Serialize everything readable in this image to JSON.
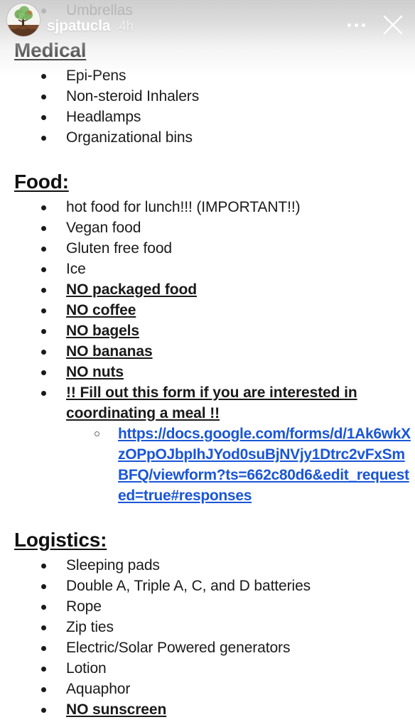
{
  "story": {
    "username": "sjpatucla",
    "timestamp": "4h",
    "avatar_alt": "tree-avatar",
    "more_options_label": "More options",
    "close_label": "Close"
  },
  "colors": {
    "link": "#1a56d6",
    "text": "#1a1a1a",
    "overlay_text": "#ffffff",
    "background": "#ffffff"
  },
  "note": {
    "partial_top_item": "Umbrellas",
    "sections": [
      {
        "heading": "Medical",
        "items": [
          {
            "text": "Epi-Pens",
            "strong": false
          },
          {
            "text": "Non-steroid Inhalers",
            "strong": false
          },
          {
            "text": "Headlamps",
            "strong": false
          },
          {
            "text": "Organizational bins",
            "strong": false
          }
        ]
      },
      {
        "heading": "Food:",
        "items": [
          {
            "text": "hot food for lunch!!! (IMPORTANT!!)",
            "strong": false
          },
          {
            "text": "Vegan food",
            "strong": false
          },
          {
            "text": "Gluten free food",
            "strong": false
          },
          {
            "text": "Ice",
            "strong": false
          },
          {
            "text": "NO packaged food",
            "strong": true
          },
          {
            "text": "NO coffee",
            "strong": true
          },
          {
            "text": "NO bagels",
            "strong": true
          },
          {
            "text": "NO bananas",
            "strong": true
          },
          {
            "text": "NO nuts",
            "strong": true
          },
          {
            "text": "!! Fill out this form if you are interested in coordinating a meal !!",
            "strong": true
          }
        ],
        "sub_item_link": "https://docs.google.com/forms/d/1Ak6wkXzOPpOJbpIhJYod0suBjNVjy1Dtrc2vFxSmBFQ/viewform?ts=662c80d6&edit_requested=true#responses"
      },
      {
        "heading": "Logistics:",
        "items": [
          {
            "text": "Sleeping pads",
            "strong": false
          },
          {
            "text": "Double A, Triple A, C, and D batteries",
            "strong": false
          },
          {
            "text": "Rope",
            "strong": false
          },
          {
            "text": "Zip ties",
            "strong": false
          },
          {
            "text": "Electric/Solar Powered generators",
            "strong": false
          },
          {
            "text": "Lotion",
            "strong": false
          },
          {
            "text": "Aquaphor",
            "strong": false
          },
          {
            "text": "NO sunscreen",
            "strong": true
          }
        ]
      }
    ]
  }
}
